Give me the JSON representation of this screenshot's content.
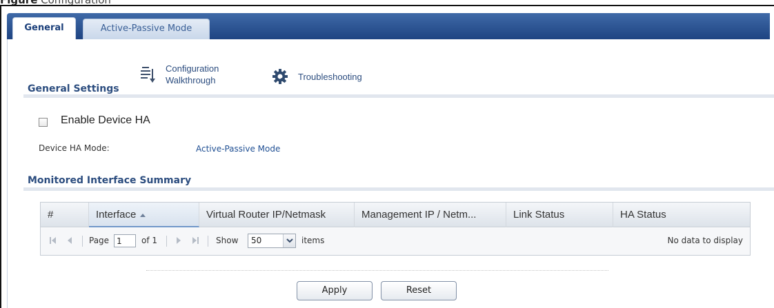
{
  "figure_caption": {
    "prefix": "Figure",
    "text": "Configuration"
  },
  "tabs": [
    {
      "label": "General",
      "active": true
    },
    {
      "label": "Active-Passive Mode",
      "active": false
    }
  ],
  "general_settings": {
    "title": "General Settings",
    "tools": [
      {
        "line1": "Configuration",
        "line2": "Walkthrough",
        "icon": "config-walkthrough-icon"
      },
      {
        "label": "Troubleshooting",
        "icon": "troubleshooting-gear-icon"
      }
    ],
    "enable_checkbox": {
      "label": "Enable Device HA",
      "checked": false
    },
    "mode": {
      "label": "Device HA Mode:",
      "value": "Active-Passive Mode"
    }
  },
  "monitored": {
    "title": "Monitored Interface Summary",
    "columns": [
      "#",
      "Interface",
      "Virtual Router IP/Netmask",
      "Management IP / Netm...",
      "Link Status",
      "HA Status"
    ],
    "sorted_column": "Interface",
    "rows": [],
    "pager": {
      "page_label": "Page",
      "page_value": "1",
      "of_label": "of 1",
      "show_label": "Show",
      "show_value": "50",
      "items_label": "items",
      "empty_text": "No data to display"
    }
  },
  "buttons": {
    "apply": "Apply",
    "reset": "Reset"
  },
  "colors": {
    "tabbar": "#2a528f",
    "section_title": "#2c4d7f",
    "link": "#1f4f93"
  }
}
